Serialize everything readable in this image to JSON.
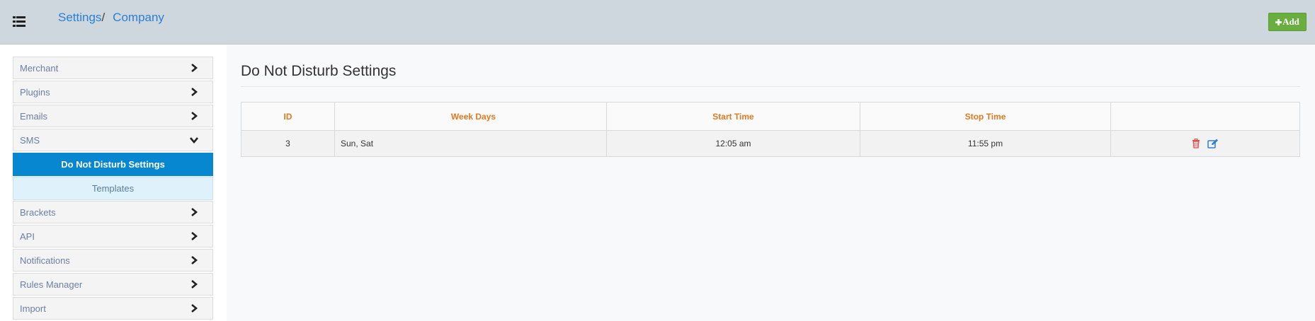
{
  "header": {
    "breadcrumb": [
      "Settings",
      "Company"
    ],
    "separator": "/",
    "add_button": {
      "icon": "plus",
      "label": "Add"
    }
  },
  "sidebar": {
    "items": [
      {
        "label": "Merchant",
        "icon": "chevron-right-icon"
      },
      {
        "label": "Plugins",
        "icon": "chevron-right-icon"
      },
      {
        "label": "Emails",
        "icon": "chevron-right-icon"
      },
      {
        "label": "SMS",
        "icon": "chevron-down-icon",
        "expanded": true,
        "children": [
          {
            "label": "Do Not Disturb Settings",
            "active": true
          },
          {
            "label": "Templates",
            "active": false
          }
        ]
      },
      {
        "label": "Brackets",
        "icon": "chevron-right-icon"
      },
      {
        "label": "API",
        "icon": "chevron-right-icon"
      },
      {
        "label": "Notifications",
        "icon": "chevron-right-icon"
      },
      {
        "label": "Rules Manager",
        "icon": "chevron-right-icon"
      },
      {
        "label": "Import",
        "icon": "chevron-right-icon"
      }
    ]
  },
  "main": {
    "title": "Do Not Disturb Settings",
    "table": {
      "columns": [
        "ID",
        "Week Days",
        "Start Time",
        "Stop Time",
        ""
      ],
      "rows": [
        {
          "id": "3",
          "week_days": "Sun, Sat",
          "start_time": "12:05 am",
          "stop_time": "11:55 pm",
          "actions": [
            "trash-icon",
            "edit-icon"
          ]
        }
      ]
    }
  },
  "colors": {
    "topbar": "#cdd7dd",
    "link": "#2b7fd6",
    "add_button": "#6aae3f",
    "active_item": "#0787d0",
    "table_header_text": "#e07a1f",
    "delete_icon": "#e04b4b",
    "edit_icon": "#2b7fd6"
  }
}
